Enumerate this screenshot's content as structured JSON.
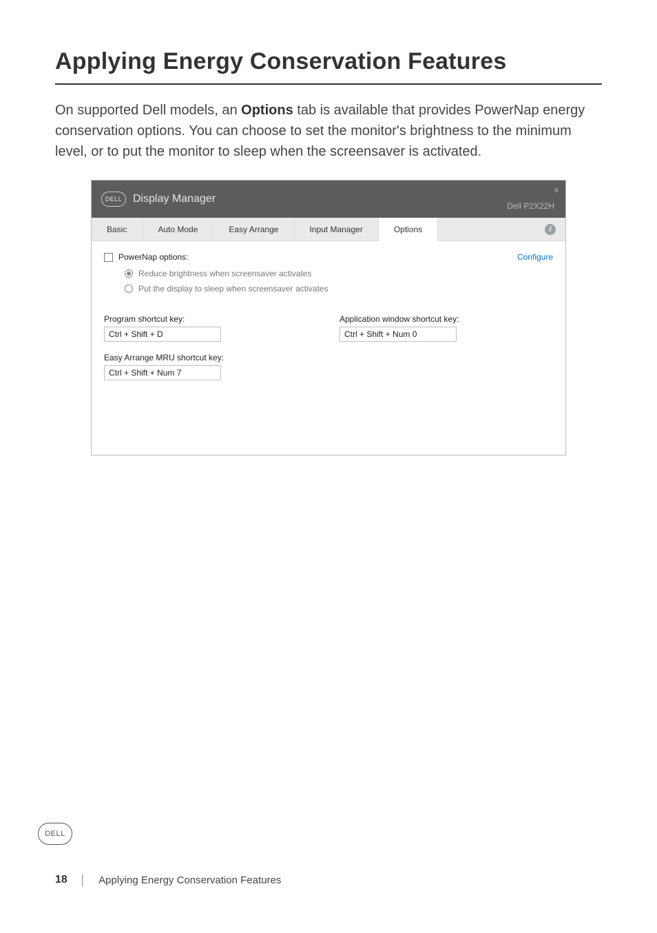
{
  "page": {
    "title": "Applying Energy Conservation Features",
    "body_before": "On supported Dell models, an ",
    "body_bold": "Options",
    "body_after": " tab is available that provides PowerNap energy conservation options. You can choose to set the monitor's brightness to the minimum level, or to put the monitor to sleep when the screensaver is activated.",
    "page_number": "18",
    "footer_pipe": "│",
    "footer_section": "Applying Energy Conservation Features",
    "dell_logo_text": "DELL"
  },
  "window": {
    "logo_text": "DELL",
    "title": "Display Manager",
    "model": "Dell P2X22H",
    "close_glyph": "x",
    "info_glyph": "i",
    "tabs": {
      "basic": "Basic",
      "auto_mode": "Auto Mode",
      "easy_arrange": "Easy Arrange",
      "input_manager": "Input Manager",
      "options": "Options"
    },
    "powernap": {
      "checkbox_label": "PowerNap options:",
      "configure": "Configure",
      "radio1": "Reduce brightness when screensaver activates",
      "radio2": "Put the display to sleep when screensaver activates"
    },
    "shortcuts": {
      "program_label": "Program shortcut key:",
      "program_value": "Ctrl + Shift + D",
      "appwin_label": "Application window shortcut key:",
      "appwin_value": "Ctrl + Shift + Num 0",
      "mru_label": "Easy Arrange MRU shortcut key:",
      "mru_value": "Ctrl + Shift + Num 7"
    }
  }
}
